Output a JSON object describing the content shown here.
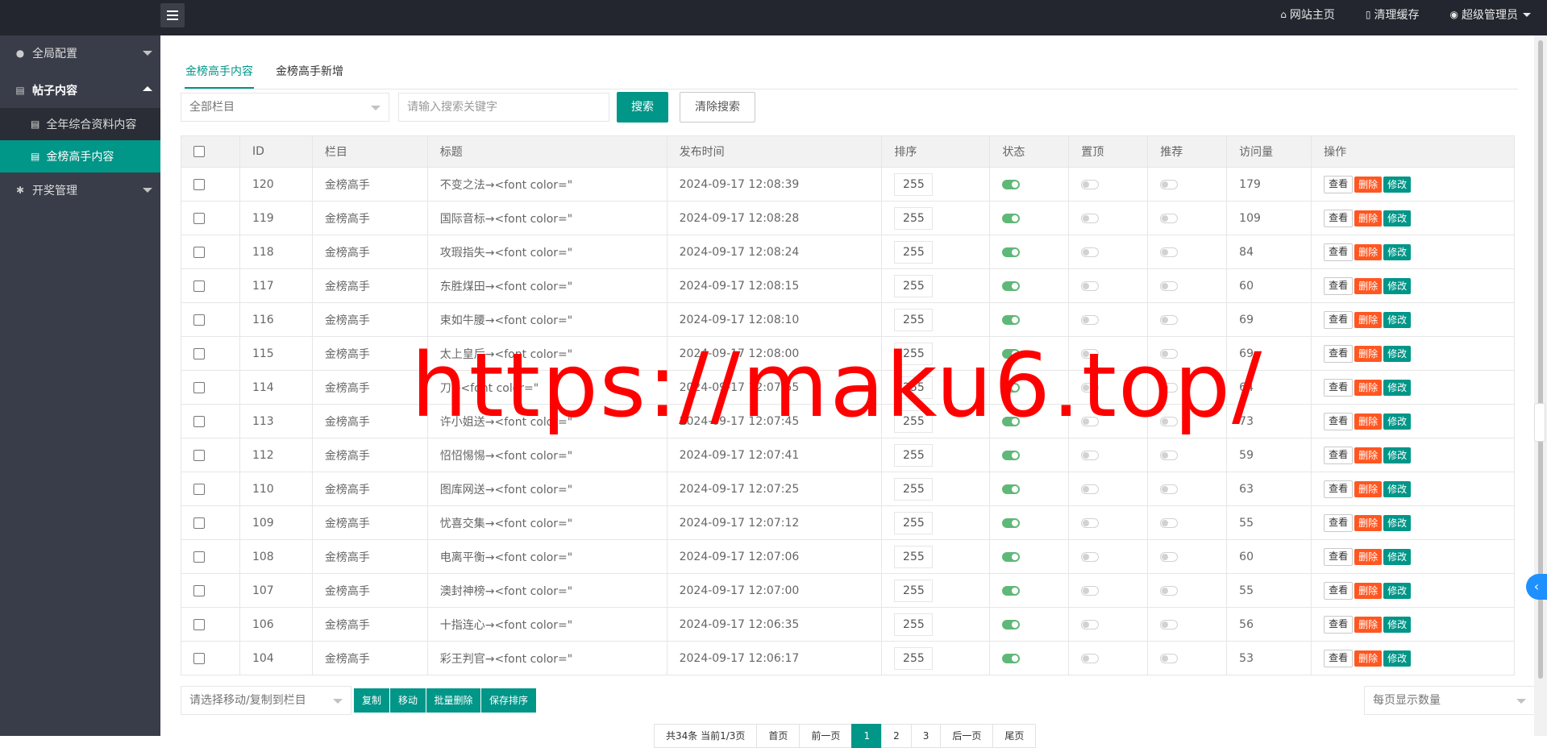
{
  "topbar": {
    "nav": [
      {
        "icon": "home-icon",
        "glyph": "⌂",
        "label": "网站主页"
      },
      {
        "icon": "trash-icon",
        "glyph": "🗑",
        "label": "清理缓存"
      },
      {
        "icon": "user-icon",
        "glyph": "☺",
        "label": "超级管理员"
      }
    ]
  },
  "sidebar": {
    "sections": [
      {
        "label": "全局配置",
        "icon": "globe-icon"
      },
      {
        "label": "帖子内容",
        "icon": "file-icon"
      },
      {
        "label": "开奖管理",
        "icon": "gear-icon"
      }
    ],
    "children": [
      {
        "label": "全年综合资料内容",
        "icon": "document-icon"
      },
      {
        "label": "金榜高手内容",
        "icon": "document-icon"
      }
    ]
  },
  "tabs": [
    "金榜高手内容",
    "金榜高手新增"
  ],
  "filters": {
    "column_select": "全部栏目",
    "keyword_placeholder": "请输入搜索关键字",
    "search_label": "搜索",
    "clear_label": "清除搜索"
  },
  "table": {
    "headers": [
      "ID",
      "栏目",
      "标题",
      "发布时间",
      "排序",
      "状态",
      "置顶",
      "推荐",
      "访问量",
      "操作"
    ],
    "rows": [
      {
        "id": "120",
        "column": "金榜高手",
        "title": "不变之法→<font color=\"",
        "time": "2024-09-17 12:08:39",
        "sort": "255",
        "status": true,
        "top": false,
        "rec": false,
        "views": "179"
      },
      {
        "id": "119",
        "column": "金榜高手",
        "title": "国际音标→<font color=\"",
        "time": "2024-09-17 12:08:28",
        "sort": "255",
        "status": true,
        "top": false,
        "rec": false,
        "views": "109"
      },
      {
        "id": "118",
        "column": "金榜高手",
        "title": "攻瑕指失→<font color=\"",
        "time": "2024-09-17 12:08:24",
        "sort": "255",
        "status": true,
        "top": false,
        "rec": false,
        "views": "84"
      },
      {
        "id": "117",
        "column": "金榜高手",
        "title": "东胜煤田→<font color=\"",
        "time": "2024-09-17 12:08:15",
        "sort": "255",
        "status": true,
        "top": false,
        "rec": false,
        "views": "60"
      },
      {
        "id": "116",
        "column": "金榜高手",
        "title": "束如牛腰→<font color=\"",
        "time": "2024-09-17 12:08:10",
        "sort": "255",
        "status": true,
        "top": false,
        "rec": false,
        "views": "69"
      },
      {
        "id": "115",
        "column": "金榜高手",
        "title": "太上皇后→<font color=\"",
        "time": "2024-09-17 12:08:00",
        "sort": "255",
        "status": true,
        "top": false,
        "rec": false,
        "views": "69"
      },
      {
        "id": "114",
        "column": "金榜高手",
        "title": "刀→<font color=\"",
        "time": "2024-09-17 12:07:55",
        "sort": "255",
        "status": true,
        "top": false,
        "rec": false,
        "views": "64"
      },
      {
        "id": "113",
        "column": "金榜高手",
        "title": "许小姐送→<font color=\"",
        "time": "2024-09-17 12:07:45",
        "sort": "255",
        "status": true,
        "top": false,
        "rec": false,
        "views": "73"
      },
      {
        "id": "112",
        "column": "金榜高手",
        "title": "怊怊惕惕→<font color=\"",
        "time": "2024-09-17 12:07:41",
        "sort": "255",
        "status": true,
        "top": false,
        "rec": false,
        "views": "59"
      },
      {
        "id": "110",
        "column": "金榜高手",
        "title": "图库网送→<font color=\"",
        "time": "2024-09-17 12:07:25",
        "sort": "255",
        "status": true,
        "top": false,
        "rec": false,
        "views": "63"
      },
      {
        "id": "109",
        "column": "金榜高手",
        "title": "忧喜交集→<font color=\"",
        "time": "2024-09-17 12:07:12",
        "sort": "255",
        "status": true,
        "top": false,
        "rec": false,
        "views": "55"
      },
      {
        "id": "108",
        "column": "金榜高手",
        "title": "电离平衡→<font color=\"",
        "time": "2024-09-17 12:07:06",
        "sort": "255",
        "status": true,
        "top": false,
        "rec": false,
        "views": "60"
      },
      {
        "id": "107",
        "column": "金榜高手",
        "title": "澳封神榜→<font color=\"",
        "time": "2024-09-17 12:07:00",
        "sort": "255",
        "status": true,
        "top": false,
        "rec": false,
        "views": "55"
      },
      {
        "id": "106",
        "column": "金榜高手",
        "title": "十指连心→<font color=\"",
        "time": "2024-09-17 12:06:35",
        "sort": "255",
        "status": true,
        "top": false,
        "rec": false,
        "views": "56"
      },
      {
        "id": "104",
        "column": "金榜高手",
        "title": "彩王判官→<font color=\"",
        "time": "2024-09-17 12:06:17",
        "sort": "255",
        "status": true,
        "top": false,
        "rec": false,
        "views": "53"
      }
    ],
    "actions": {
      "view": "查看",
      "delete": "删除",
      "edit": "修改"
    }
  },
  "bottom": {
    "move_select": "请选择移动/复制到栏目",
    "buttons": [
      "复制",
      "移动",
      "批量删除",
      "保存排序"
    ],
    "per_page_select": "每页显示数量"
  },
  "pager": [
    "共34条 当前1/3页",
    "首页",
    "前一页",
    "1",
    "2",
    "3",
    "后一页",
    "尾页"
  ],
  "pager_current": "1",
  "watermark": "https://maku6.top/",
  "colors": {
    "accent": "#009688",
    "danger": "#ff5722",
    "switch_on": "#5fb878",
    "sidebar": "#393d49",
    "topbar": "#23262e"
  }
}
